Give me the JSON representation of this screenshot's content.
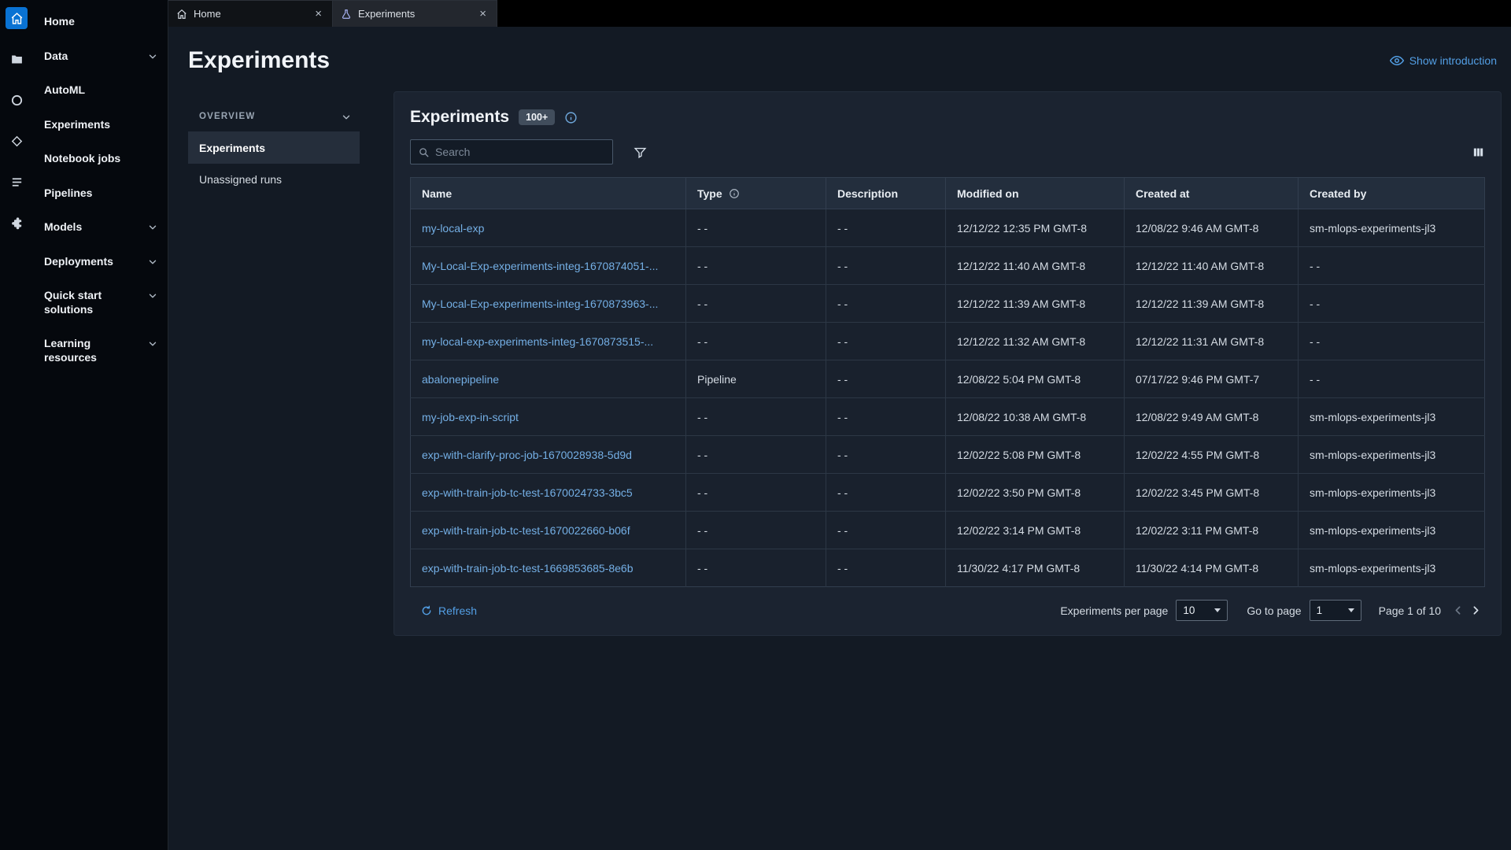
{
  "colors": {
    "accent": "#539fe5",
    "link": "#74afe5",
    "rail_active": "#0972d3"
  },
  "icon_rail": {
    "icons": [
      "home",
      "file-browser",
      "running-terminals",
      "git",
      "table-of-contents",
      "extensions"
    ]
  },
  "sidebar": {
    "items": [
      {
        "label": "Home",
        "expandable": false
      },
      {
        "label": "Data",
        "expandable": true
      },
      {
        "label": "AutoML",
        "expandable": false
      },
      {
        "label": "Experiments",
        "expandable": false
      },
      {
        "label": "Notebook jobs",
        "expandable": false
      },
      {
        "label": "Pipelines",
        "expandable": false
      },
      {
        "label": "Models",
        "expandable": true
      },
      {
        "label": "Deployments",
        "expandable": true
      },
      {
        "label": "Quick start solutions",
        "expandable": true
      },
      {
        "label": "Learning resources",
        "expandable": true
      }
    ]
  },
  "tabs": [
    {
      "label": "Home",
      "active": false
    },
    {
      "label": "Experiments",
      "active": true
    }
  ],
  "page": {
    "title": "Experiments",
    "show_introduction": "Show introduction"
  },
  "subnav": {
    "section": "OVERVIEW",
    "items": [
      {
        "label": "Experiments",
        "selected": true
      },
      {
        "label": "Unassigned runs",
        "selected": false
      }
    ]
  },
  "panel": {
    "title": "Experiments",
    "count_badge": "100+",
    "search_placeholder": "Search",
    "table": {
      "columns": [
        "Name",
        "Type",
        "Description",
        "Modified on",
        "Created at",
        "Created by"
      ],
      "rows": [
        {
          "name": "my-local-exp",
          "type": "- -",
          "description": "- -",
          "modified_on": "12/12/22 12:35 PM GMT-8",
          "created_at": "12/08/22 9:46 AM GMT-8",
          "created_by": "sm-mlops-experiments-jl3"
        },
        {
          "name": "My-Local-Exp-experiments-integ-1670874051-...",
          "type": "- -",
          "description": "- -",
          "modified_on": "12/12/22 11:40 AM GMT-8",
          "created_at": "12/12/22 11:40 AM GMT-8",
          "created_by": "- -"
        },
        {
          "name": "My-Local-Exp-experiments-integ-1670873963-...",
          "type": "- -",
          "description": "- -",
          "modified_on": "12/12/22 11:39 AM GMT-8",
          "created_at": "12/12/22 11:39 AM GMT-8",
          "created_by": "- -"
        },
        {
          "name": "my-local-exp-experiments-integ-1670873515-...",
          "type": "- -",
          "description": "- -",
          "modified_on": "12/12/22 11:32 AM GMT-8",
          "created_at": "12/12/22 11:31 AM GMT-8",
          "created_by": "- -"
        },
        {
          "name": "abalonepipeline",
          "type": "Pipeline",
          "description": "- -",
          "modified_on": "12/08/22 5:04 PM GMT-8",
          "created_at": "07/17/22 9:46 PM GMT-7",
          "created_by": "- -"
        },
        {
          "name": "my-job-exp-in-script",
          "type": "- -",
          "description": "- -",
          "modified_on": "12/08/22 10:38 AM GMT-8",
          "created_at": "12/08/22 9:49 AM GMT-8",
          "created_by": "sm-mlops-experiments-jl3"
        },
        {
          "name": "exp-with-clarify-proc-job-1670028938-5d9d",
          "type": "- -",
          "description": "- -",
          "modified_on": "12/02/22 5:08 PM GMT-8",
          "created_at": "12/02/22 4:55 PM GMT-8",
          "created_by": "sm-mlops-experiments-jl3"
        },
        {
          "name": "exp-with-train-job-tc-test-1670024733-3bc5",
          "type": "- -",
          "description": "- -",
          "modified_on": "12/02/22 3:50 PM GMT-8",
          "created_at": "12/02/22 3:45 PM GMT-8",
          "created_by": "sm-mlops-experiments-jl3"
        },
        {
          "name": "exp-with-train-job-tc-test-1670022660-b06f",
          "type": "- -",
          "description": "- -",
          "modified_on": "12/02/22 3:14 PM GMT-8",
          "created_at": "12/02/22 3:11 PM GMT-8",
          "created_by": "sm-mlops-experiments-jl3"
        },
        {
          "name": "exp-with-train-job-tc-test-1669853685-8e6b",
          "type": "- -",
          "description": "- -",
          "modified_on": "11/30/22 4:17 PM GMT-8",
          "created_at": "11/30/22 4:14 PM GMT-8",
          "created_by": "sm-mlops-experiments-jl3"
        }
      ]
    },
    "footer": {
      "refresh_label": "Refresh",
      "per_page_label": "Experiments per page",
      "per_page_value": "10",
      "go_to_page_label": "Go to page",
      "go_to_page_value": "1",
      "page_status": "Page 1 of 10"
    }
  }
}
